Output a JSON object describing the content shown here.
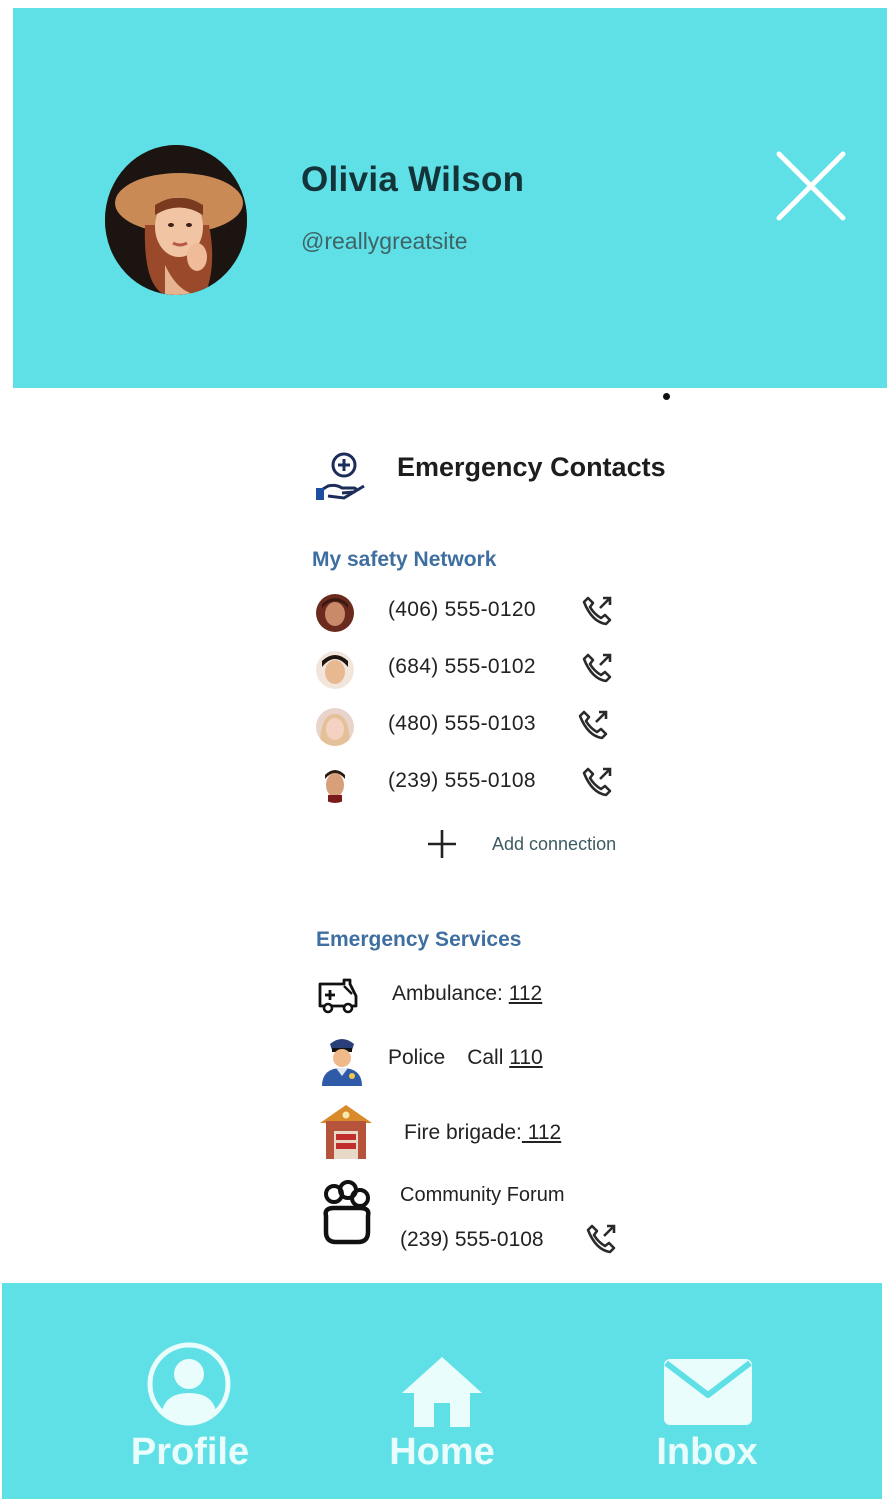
{
  "colors": {
    "accent": "#5fe0e6",
    "heading": "#13353a",
    "subheading": "#3f6fa0",
    "nav_text": "#eafdfd"
  },
  "profile": {
    "name": "Olivia Wilson",
    "handle": "@reallygreatsite"
  },
  "emergency_contacts": {
    "title": "Emergency Contacts",
    "icon": "hand-medical-icon"
  },
  "safety_network": {
    "heading": "My safety Network",
    "contacts": [
      {
        "phone": "(406) 555-0120"
      },
      {
        "phone": "(684) 555-0102"
      },
      {
        "phone": "(480) 555-0103"
      },
      {
        "phone": "(239) 555-0108"
      }
    ],
    "add_label": "Add connection"
  },
  "emergency_services": {
    "heading": "Emergency Services",
    "ambulance": {
      "label": "Ambulance: ",
      "number": "112",
      "icon": "ambulance-icon"
    },
    "police": {
      "label": "Police",
      "call": "Call ",
      "number": "110",
      "icon": "police-officer-icon"
    },
    "fire": {
      "label": "Fire brigade:",
      "number": " 112",
      "icon": "fire-station-icon"
    },
    "community": {
      "label": "Community Forum",
      "phone": "(239) 555-0108",
      "icon": "community-group-icon"
    }
  },
  "nav": {
    "items": [
      {
        "label": "Profile",
        "icon": "user-icon"
      },
      {
        "label": "Home",
        "icon": "home-icon"
      },
      {
        "label": "Inbox",
        "icon": "mail-icon"
      }
    ]
  }
}
